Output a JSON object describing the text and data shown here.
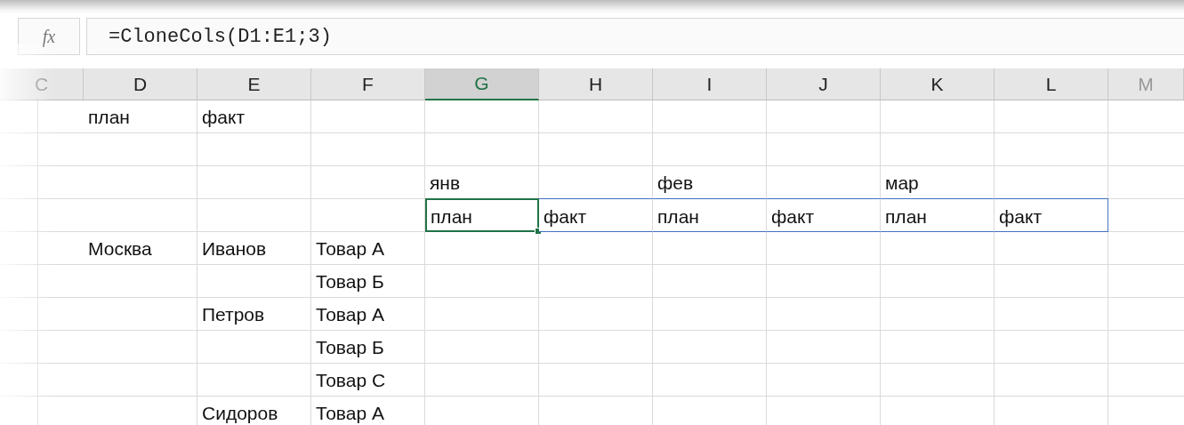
{
  "formula_bar": {
    "fx": "fx",
    "formula": "=CloneCols(D1:E1;3)"
  },
  "columns": [
    {
      "label": "C",
      "selected": false
    },
    {
      "label": "D",
      "selected": false
    },
    {
      "label": "E",
      "selected": false
    },
    {
      "label": "F",
      "selected": false
    },
    {
      "label": "G",
      "selected": true
    },
    {
      "label": "H",
      "selected": false
    },
    {
      "label": "I",
      "selected": false
    },
    {
      "label": "J",
      "selected": false
    },
    {
      "label": "K",
      "selected": false
    },
    {
      "label": "L",
      "selected": false
    },
    {
      "label": "M",
      "selected": false
    }
  ],
  "rows": [
    {
      "cells": {
        "D": {
          "text": "план"
        },
        "E": {
          "text": "факт"
        }
      }
    },
    {
      "cells": {}
    },
    {
      "cells": {
        "G": {
          "text": "янв"
        },
        "I": {
          "text": "фев"
        },
        "K": {
          "text": "мар"
        }
      }
    },
    {
      "cells": {
        "G": {
          "text": "план",
          "selected": true,
          "spill": true
        },
        "H": {
          "text": "факт",
          "selected": false,
          "spill": true
        },
        "I": {
          "text": "план",
          "selected": false,
          "spill": true
        },
        "J": {
          "text": "факт",
          "selected": false,
          "spill": true
        },
        "K": {
          "text": "план",
          "selected": false,
          "spill": true
        },
        "L": {
          "text": "факт",
          "selected": false,
          "spill": true
        }
      }
    },
    {
      "cells": {
        "D": {
          "text": "Москва"
        },
        "E": {
          "text": "Иванов"
        },
        "F": {
          "text": "Товар А"
        }
      }
    },
    {
      "cells": {
        "F": {
          "text": "Товар Б"
        }
      }
    },
    {
      "cells": {
        "E": {
          "text": "Петров"
        },
        "F": {
          "text": "Товар А"
        }
      }
    },
    {
      "cells": {
        "F": {
          "text": "Товар Б"
        }
      }
    },
    {
      "cells": {
        "F": {
          "text": "Товар С"
        }
      }
    },
    {
      "cells": {
        "E": {
          "text": "Сидоров"
        },
        "F": {
          "text": "Товар А"
        }
      }
    }
  ]
}
